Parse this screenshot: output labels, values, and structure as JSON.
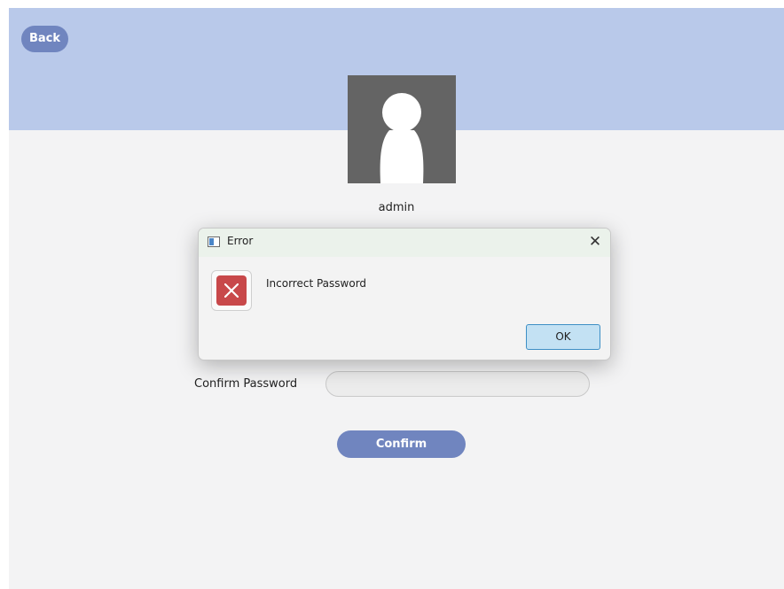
{
  "header": {
    "back_label": "Back"
  },
  "profile": {
    "username": "admin"
  },
  "form": {
    "confirm_password_label": "Confirm Password",
    "confirm_password_value": "",
    "confirm_button_label": "Confirm"
  },
  "dialog": {
    "title": "Error",
    "close_glyph": "✕",
    "message": "Incorrect Password",
    "ok_label": "OK",
    "icon": "error-icon"
  },
  "colors": {
    "banner": "#b9c9ea",
    "button": "#7085bf",
    "error_red": "#c8484a",
    "ok_button_bg": "#c3e1f3"
  }
}
